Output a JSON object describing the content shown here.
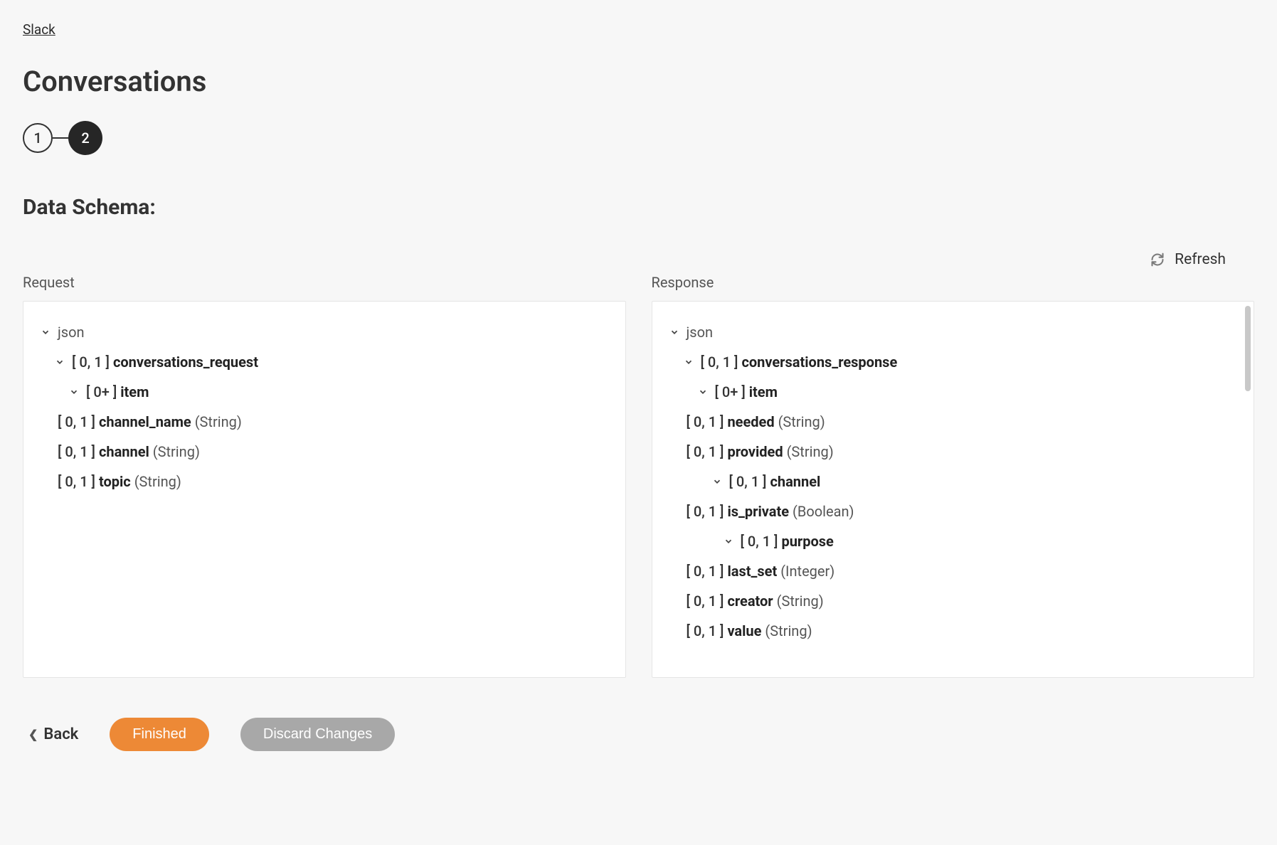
{
  "breadcrumb": {
    "label": "Slack"
  },
  "page_title": "Conversations",
  "stepper": {
    "step1": "1",
    "step2": "2"
  },
  "section_title": "Data Schema:",
  "refresh_label": "Refresh",
  "columns": {
    "request": {
      "header": "Request",
      "root": "json",
      "nodes": {
        "n1_card": "[ 0, 1 ]",
        "n1_name": "conversations_request",
        "n2_card": "[ 0+ ]",
        "n2_name": "item",
        "n3_card": "[ 0, 1 ]",
        "n3_name": "channel_name",
        "n3_type": "(String)",
        "n4_card": "[ 0, 1 ]",
        "n4_name": "channel",
        "n4_type": "(String)",
        "n5_card": "[ 0, 1 ]",
        "n5_name": "topic",
        "n5_type": "(String)"
      }
    },
    "response": {
      "header": "Response",
      "root": "json",
      "nodes": {
        "n1_card": "[ 0, 1 ]",
        "n1_name": "conversations_response",
        "n2_card": "[ 0+ ]",
        "n2_name": "item",
        "n3_card": "[ 0, 1 ]",
        "n3_name": "needed",
        "n3_type": "(String)",
        "n4_card": "[ 0, 1 ]",
        "n4_name": "provided",
        "n4_type": "(String)",
        "n5_card": "[ 0, 1 ]",
        "n5_name": "channel",
        "n6_card": "[ 0, 1 ]",
        "n6_name": "is_private",
        "n6_type": "(Boolean)",
        "n7_card": "[ 0, 1 ]",
        "n7_name": "purpose",
        "n8_card": "[ 0, 1 ]",
        "n8_name": "last_set",
        "n8_type": "(Integer)",
        "n9_card": "[ 0, 1 ]",
        "n9_name": "creator",
        "n9_type": "(String)",
        "n10_card": "[ 0, 1 ]",
        "n10_name": "value",
        "n10_type": "(String)"
      }
    }
  },
  "footer": {
    "back": "Back",
    "finished": "Finished",
    "discard": "Discard Changes"
  }
}
